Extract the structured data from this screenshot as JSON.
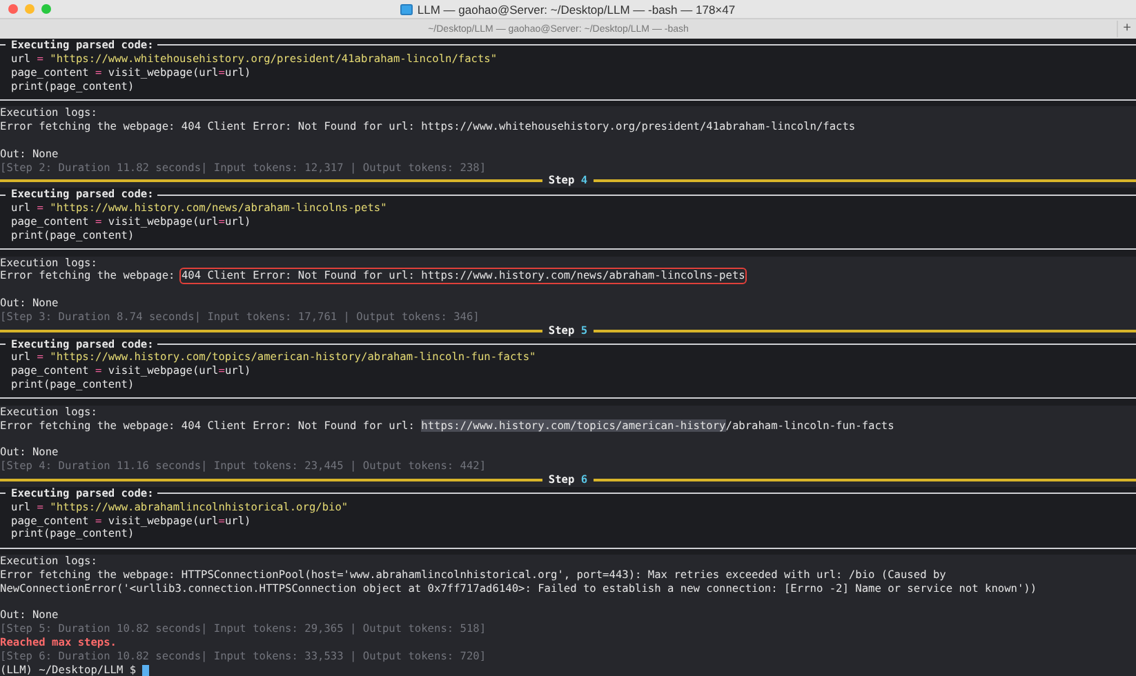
{
  "window": {
    "title": "LLM — gaohao@Server: ~/Desktop/LLM — -bash — 178×47",
    "tab_title": "~/Desktop/LLM — gaohao@Server: ~/Desktop/LLM — -bash",
    "new_tab": "+"
  },
  "terminal": [
    {
      "kind": "panel",
      "title": "Executing parsed code:",
      "code": [
        [
          {
            "kind": "name",
            "text": "url "
          },
          {
            "kind": "op",
            "text": "="
          },
          {
            "kind": "string",
            "text": " \"https://www.whitehousehistory.org/president/41abraham-lincoln/facts\""
          }
        ],
        [
          {
            "kind": "name",
            "text": "page_content "
          },
          {
            "kind": "op",
            "text": "="
          },
          {
            "kind": "name",
            "text": " visit_webpage(url"
          },
          {
            "kind": "op",
            "text": "="
          },
          {
            "kind": "name",
            "text": "url)"
          }
        ],
        [
          {
            "kind": "name",
            "text": "print(page_content)"
          }
        ]
      ]
    },
    {
      "kind": "text",
      "text": "Execution logs:"
    },
    {
      "kind": "text",
      "text": "Error fetching the webpage: 404 Client Error: Not Found for url: https://www.whitehousehistory.org/president/41abraham-lincoln/facts"
    },
    {
      "kind": "blank"
    },
    {
      "kind": "text",
      "text": "Out: None"
    },
    {
      "kind": "info",
      "text": "[Step 2: Duration 11.82 seconds| Input tokens: 12,317 | Output tokens: 238]"
    },
    {
      "kind": "rule",
      "label": "Step",
      "number": "4"
    },
    {
      "kind": "panel",
      "title": "Executing parsed code:",
      "code": [
        [
          {
            "kind": "name",
            "text": "url "
          },
          {
            "kind": "op",
            "text": "="
          },
          {
            "kind": "string",
            "text": " \"https://www.history.com/news/abraham-lincolns-pets\""
          }
        ],
        [
          {
            "kind": "name",
            "text": "page_content "
          },
          {
            "kind": "op",
            "text": "="
          },
          {
            "kind": "name",
            "text": " visit_webpage(url"
          },
          {
            "kind": "op",
            "text": "="
          },
          {
            "kind": "name",
            "text": "url)"
          }
        ],
        [
          {
            "kind": "name",
            "text": "print(page_content)"
          }
        ]
      ]
    },
    {
      "kind": "text",
      "text": "Execution logs:"
    },
    {
      "kind": "segments",
      "segments": [
        {
          "kind": "plain",
          "text": "Error fetching the webpage: "
        },
        {
          "kind": "boxed",
          "text": "404 Client Error: Not Found for url: https://www.history.com/news/abraham-lincolns-pets"
        }
      ]
    },
    {
      "kind": "blank"
    },
    {
      "kind": "text",
      "text": "Out: None"
    },
    {
      "kind": "info",
      "text": "[Step 3: Duration 8.74 seconds| Input tokens: 17,761 | Output tokens: 346]"
    },
    {
      "kind": "rule",
      "label": "Step",
      "number": "5"
    },
    {
      "kind": "panel",
      "title": "Executing parsed code:",
      "code": [
        [
          {
            "kind": "name",
            "text": "url "
          },
          {
            "kind": "op",
            "text": "="
          },
          {
            "kind": "string",
            "text": " \"https://www.history.com/topics/american-history/abraham-lincoln-fun-facts\""
          }
        ],
        [
          {
            "kind": "name",
            "text": "page_content "
          },
          {
            "kind": "op",
            "text": "="
          },
          {
            "kind": "name",
            "text": " visit_webpage(url"
          },
          {
            "kind": "op",
            "text": "="
          },
          {
            "kind": "name",
            "text": "url)"
          }
        ],
        [
          {
            "kind": "name",
            "text": "print(page_content)"
          }
        ]
      ]
    },
    {
      "kind": "text",
      "text": "Execution logs:"
    },
    {
      "kind": "segments",
      "segments": [
        {
          "kind": "plain",
          "text": "Error fetching the webpage: 404 Client Error: Not Found for url: "
        },
        {
          "kind": "selected",
          "text": "https://www.history.com/topics/american-history"
        },
        {
          "kind": "plain",
          "text": "/abraham-lincoln-fun-facts"
        }
      ]
    },
    {
      "kind": "blank"
    },
    {
      "kind": "text",
      "text": "Out: None"
    },
    {
      "kind": "info",
      "text": "[Step 4: Duration 11.16 seconds| Input tokens: 23,445 | Output tokens: 442]"
    },
    {
      "kind": "rule",
      "label": "Step",
      "number": "6"
    },
    {
      "kind": "panel",
      "title": "Executing parsed code:",
      "code": [
        [
          {
            "kind": "name",
            "text": "url "
          },
          {
            "kind": "op",
            "text": "="
          },
          {
            "kind": "string",
            "text": " \"https://www.abrahamlincolnhistorical.org/bio\""
          }
        ],
        [
          {
            "kind": "name",
            "text": "page_content "
          },
          {
            "kind": "op",
            "text": "="
          },
          {
            "kind": "name",
            "text": " visit_webpage(url"
          },
          {
            "kind": "op",
            "text": "="
          },
          {
            "kind": "name",
            "text": "url)"
          }
        ],
        [
          {
            "kind": "name",
            "text": "print(page_content)"
          }
        ]
      ]
    },
    {
      "kind": "text",
      "text": "Execution logs:"
    },
    {
      "kind": "text",
      "text": "Error fetching the webpage: HTTPSConnectionPool(host='www.abrahamlincolnhistorical.org', port=443): Max retries exceeded with url: /bio (Caused by"
    },
    {
      "kind": "text",
      "text": "NewConnectionError('<urllib3.connection.HTTPSConnection object at 0x7ff717ad6140>: Failed to establish a new connection: [Errno -2] Name or service not known'))"
    },
    {
      "kind": "blank"
    },
    {
      "kind": "text",
      "text": "Out: None"
    },
    {
      "kind": "info",
      "text": "[Step 5: Duration 10.82 seconds| Input tokens: 29,365 | Output tokens: 518]"
    },
    {
      "kind": "alert",
      "text": "Reached max steps."
    },
    {
      "kind": "info",
      "text": "[Step 6: Duration 10.82 seconds| Input tokens: 33,533 | Output tokens: 720]"
    },
    {
      "kind": "prompt",
      "text": "(LLM) ~/Desktop/LLM $"
    }
  ]
}
